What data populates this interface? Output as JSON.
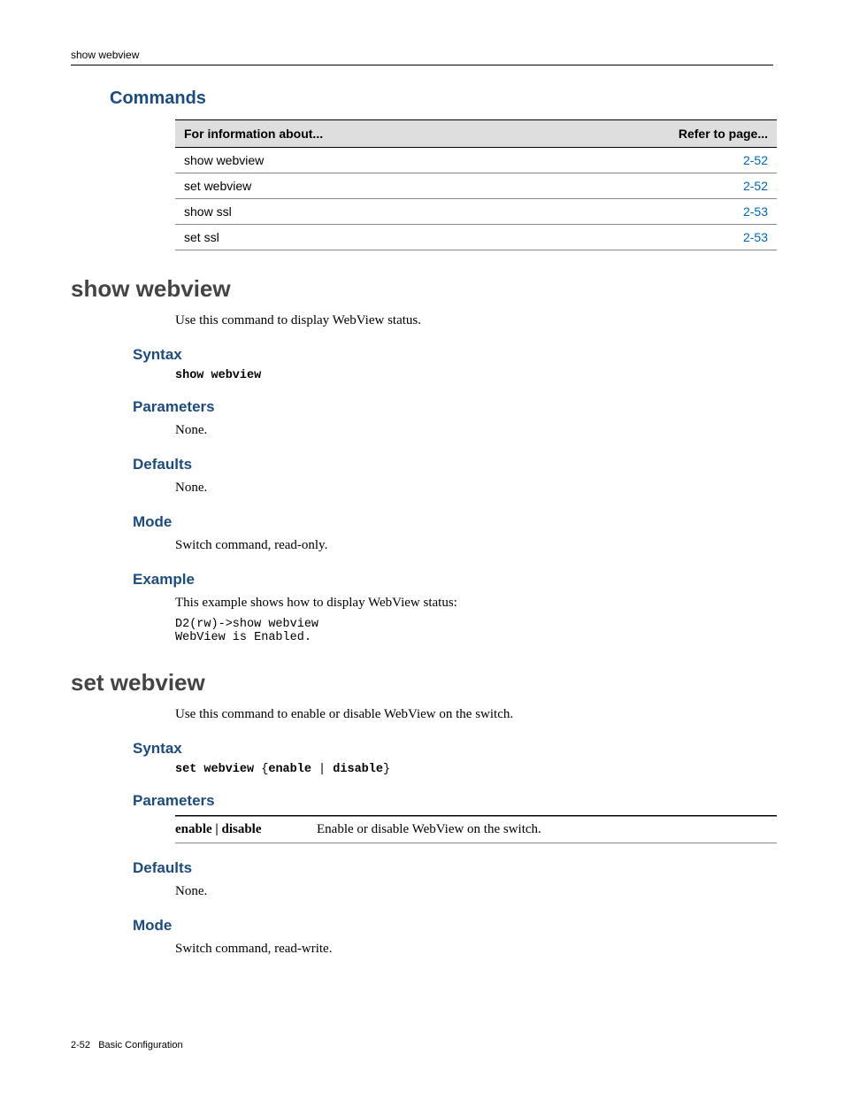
{
  "running_head": "show webview",
  "commands_heading": "Commands",
  "cmd_table": {
    "headers": {
      "left": "For information about...",
      "right": "Refer to page..."
    },
    "rows": [
      {
        "name": "show webview",
        "page": "2-52"
      },
      {
        "name": "set webview",
        "page": "2-52"
      },
      {
        "name": "show ssl",
        "page": "2-53"
      },
      {
        "name": "set ssl",
        "page": "2-53"
      }
    ]
  },
  "cmd1": {
    "title": "show webview",
    "intro": "Use this command to display WebView status.",
    "syntax_label": "Syntax",
    "syntax": "show webview",
    "params_label": "Parameters",
    "params_text": "None.",
    "defaults_label": "Defaults",
    "defaults_text": "None.",
    "mode_label": "Mode",
    "mode_text": "Switch command, read‑only.",
    "example_label": "Example",
    "example_intro": "This example shows how to display WebView status:",
    "example_block": "D2(rw)->show webview\nWebView is Enabled."
  },
  "cmd2": {
    "title": "set webview",
    "intro": "Use this command to enable or disable WebView on the switch.",
    "syntax_label": "Syntax",
    "syntax_bold1": "set webview",
    "syntax_brace_open": "{",
    "syntax_bold2": "enable",
    "syntax_pipe": " | ",
    "syntax_bold3": "disable",
    "syntax_brace_close": "}",
    "params_label": "Parameters",
    "param_key": "enable | disable",
    "param_desc": "Enable or disable WebView on the switch.",
    "defaults_label": "Defaults",
    "defaults_text": "None.",
    "mode_label": "Mode",
    "mode_text": "Switch command, read‑write."
  },
  "footer": {
    "page_num": "2-52",
    "chapter": "Basic Configuration"
  }
}
